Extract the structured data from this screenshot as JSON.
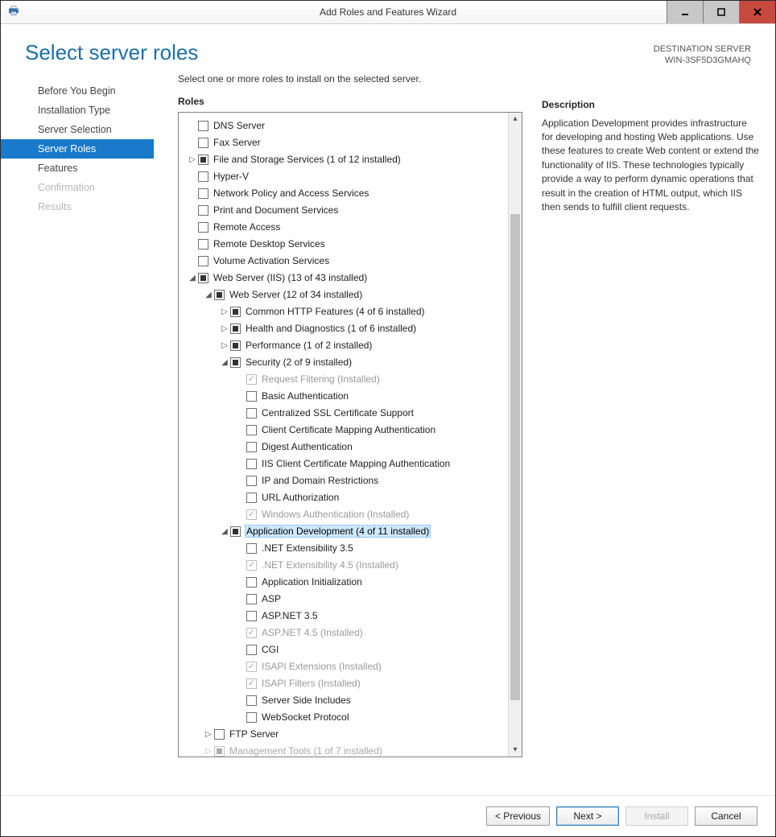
{
  "window": {
    "title": "Add Roles and Features Wizard"
  },
  "header": {
    "page_title": "Select server roles",
    "destination_label": "DESTINATION SERVER",
    "destination_value": "WIN-3SF5D3GMAHQ"
  },
  "sidebar": {
    "items": [
      {
        "label": "Before You Begin",
        "state": "normal"
      },
      {
        "label": "Installation Type",
        "state": "normal"
      },
      {
        "label": "Server Selection",
        "state": "normal"
      },
      {
        "label": "Server Roles",
        "state": "active"
      },
      {
        "label": "Features",
        "state": "normal"
      },
      {
        "label": "Confirmation",
        "state": "disabled"
      },
      {
        "label": "Results",
        "state": "disabled"
      }
    ]
  },
  "center": {
    "instruction": "Select one or more roles to install on the selected server.",
    "section_label": "Roles"
  },
  "tree": [
    {
      "indent": 0,
      "label": "DNS Server",
      "check": "unchecked"
    },
    {
      "indent": 0,
      "label": "Fax Server",
      "check": "unchecked"
    },
    {
      "indent": 0,
      "label": "File and Storage Services (1 of 12 installed)",
      "check": "indeterminate",
      "expander": "collapsed"
    },
    {
      "indent": 0,
      "label": "Hyper-V",
      "check": "unchecked"
    },
    {
      "indent": 0,
      "label": "Network Policy and Access Services",
      "check": "unchecked"
    },
    {
      "indent": 0,
      "label": "Print and Document Services",
      "check": "unchecked"
    },
    {
      "indent": 0,
      "label": "Remote Access",
      "check": "unchecked"
    },
    {
      "indent": 0,
      "label": "Remote Desktop Services",
      "check": "unchecked"
    },
    {
      "indent": 0,
      "label": "Volume Activation Services",
      "check": "unchecked"
    },
    {
      "indent": 0,
      "label": "Web Server (IIS) (13 of 43 installed)",
      "check": "indeterminate",
      "expander": "expanded"
    },
    {
      "indent": 1,
      "label": "Web Server (12 of 34 installed)",
      "check": "indeterminate",
      "expander": "expanded"
    },
    {
      "indent": 2,
      "label": "Common HTTP Features (4 of 6 installed)",
      "check": "indeterminate",
      "expander": "collapsed"
    },
    {
      "indent": 2,
      "label": "Health and Diagnostics (1 of 6 installed)",
      "check": "indeterminate",
      "expander": "collapsed"
    },
    {
      "indent": 2,
      "label": "Performance (1 of 2 installed)",
      "check": "indeterminate",
      "expander": "collapsed"
    },
    {
      "indent": 2,
      "label": "Security (2 of 9 installed)",
      "check": "indeterminate",
      "expander": "expanded"
    },
    {
      "indent": 3,
      "label": "Request Filtering (Installed)",
      "check": "checked",
      "disabled": true
    },
    {
      "indent": 3,
      "label": "Basic Authentication",
      "check": "unchecked"
    },
    {
      "indent": 3,
      "label": "Centralized SSL Certificate Support",
      "check": "unchecked"
    },
    {
      "indent": 3,
      "label": "Client Certificate Mapping Authentication",
      "check": "unchecked"
    },
    {
      "indent": 3,
      "label": "Digest Authentication",
      "check": "unchecked"
    },
    {
      "indent": 3,
      "label": "IIS Client Certificate Mapping Authentication",
      "check": "unchecked"
    },
    {
      "indent": 3,
      "label": "IP and Domain Restrictions",
      "check": "unchecked"
    },
    {
      "indent": 3,
      "label": "URL Authorization",
      "check": "unchecked"
    },
    {
      "indent": 3,
      "label": "Windows Authentication (Installed)",
      "check": "checked",
      "disabled": true
    },
    {
      "indent": 2,
      "label": "Application Development (4 of 11 installed)",
      "check": "indeterminate",
      "expander": "expanded",
      "selected": true
    },
    {
      "indent": 3,
      "label": ".NET Extensibility 3.5",
      "check": "unchecked"
    },
    {
      "indent": 3,
      "label": ".NET Extensibility 4.5 (Installed)",
      "check": "checked",
      "disabled": true
    },
    {
      "indent": 3,
      "label": "Application Initialization",
      "check": "unchecked"
    },
    {
      "indent": 3,
      "label": "ASP",
      "check": "unchecked"
    },
    {
      "indent": 3,
      "label": "ASP.NET 3.5",
      "check": "unchecked"
    },
    {
      "indent": 3,
      "label": "ASP.NET 4.5 (Installed)",
      "check": "checked",
      "disabled": true
    },
    {
      "indent": 3,
      "label": "CGI",
      "check": "unchecked"
    },
    {
      "indent": 3,
      "label": "ISAPI Extensions (Installed)",
      "check": "checked",
      "disabled": true
    },
    {
      "indent": 3,
      "label": "ISAPI Filters (Installed)",
      "check": "checked",
      "disabled": true
    },
    {
      "indent": 3,
      "label": "Server Side Includes",
      "check": "unchecked"
    },
    {
      "indent": 3,
      "label": "WebSocket Protocol",
      "check": "unchecked"
    },
    {
      "indent": 1,
      "label": "FTP Server",
      "check": "unchecked",
      "expander": "collapsed"
    },
    {
      "indent": 1,
      "label": "Management Tools (1 of 7 installed)",
      "check": "indeterminate",
      "expander": "collapsed",
      "cut": true
    }
  ],
  "description": {
    "title": "Description",
    "body": "Application Development provides infrastructure for developing and hosting Web applications. Use these features to create Web content or extend the functionality of IIS. These technologies typically provide a way to perform dynamic operations that result in the creation of HTML output, which IIS then sends to fulfill client requests."
  },
  "footer": {
    "previous": "< Previous",
    "next": "Next >",
    "install": "Install",
    "cancel": "Cancel"
  }
}
